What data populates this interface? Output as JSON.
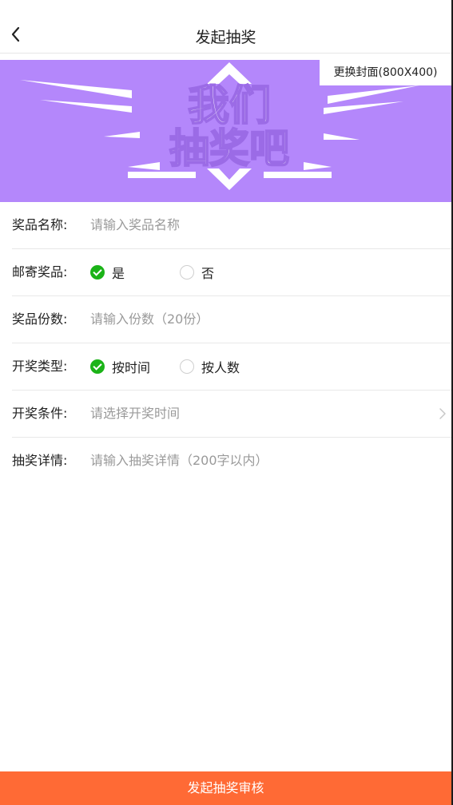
{
  "nav": {
    "title": "发起抽奖"
  },
  "cover": {
    "change_label": "更换封面(800X400)",
    "banner_text_line1": "我们",
    "banner_text_line2": "抽奖吧",
    "background_color": "#b487fb"
  },
  "form": {
    "prize_name": {
      "label": "奖品名称:",
      "placeholder": "请输入奖品名称"
    },
    "mail_prize": {
      "label": "邮寄奖品:",
      "options": [
        "是",
        "否"
      ],
      "selected": "是"
    },
    "prize_count": {
      "label": "奖品份数:",
      "placeholder": "请输入份数（20份）"
    },
    "draw_type": {
      "label": "开奖类型:",
      "options": [
        "按时间",
        "按人数"
      ],
      "selected": "按时间"
    },
    "draw_condition": {
      "label": "开奖条件:",
      "placeholder": "请选择开奖时间"
    },
    "draw_details": {
      "label": "抽奖详情:",
      "placeholder": "请输入抽奖详情（200字以内）"
    }
  },
  "submit": {
    "label": "发起抽奖审核",
    "color": "#ff6a35"
  },
  "colors": {
    "check_green": "#1bb318",
    "placeholder_gray": "#9a9a9a"
  }
}
